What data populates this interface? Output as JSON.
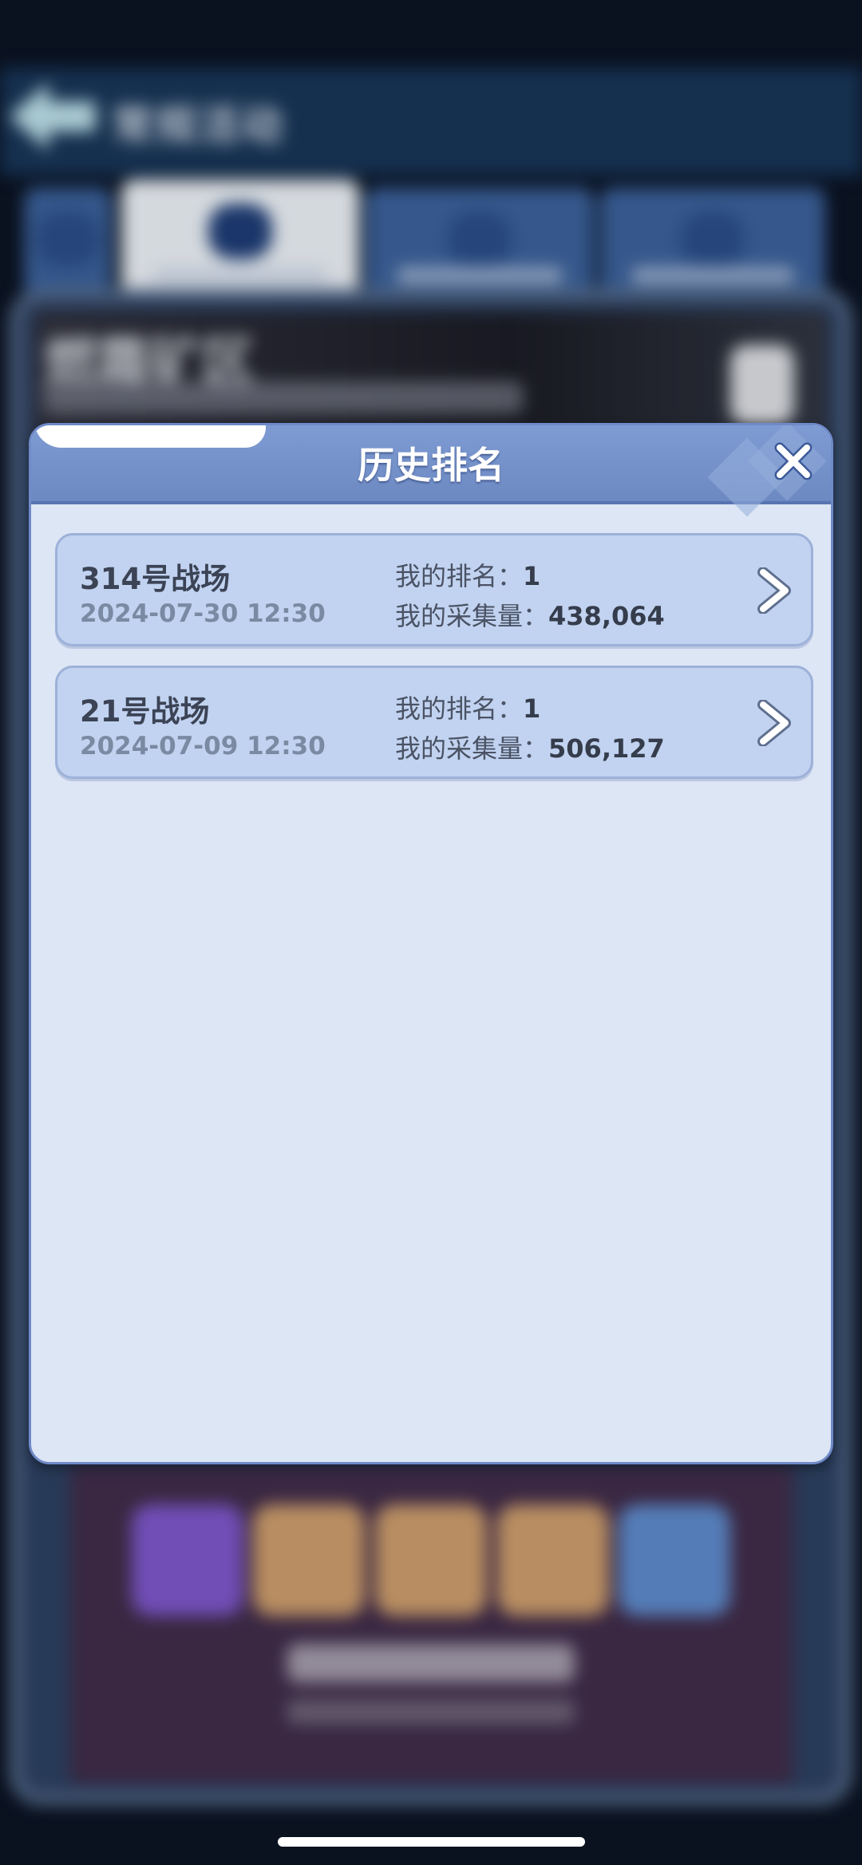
{
  "background": {
    "header_title": "常规活动",
    "banner_title": "燃霜矿区"
  },
  "modal": {
    "title": "历史排名",
    "rank_label": "我的排名：",
    "collect_label": "我的采集量：",
    "records": [
      {
        "battlefield": "314号战场",
        "datetime": "2024-07-30 12:30",
        "rank": "1",
        "collected": "438,064"
      },
      {
        "battlefield": "21号战场",
        "datetime": "2024-07-09 12:30",
        "rank": "1",
        "collected": "506,127"
      }
    ]
  },
  "colors": {
    "header_blue": "#7e9bd3",
    "panel_bg": "#dde6f5",
    "row_bg": "#c1d3f0"
  },
  "icons": [
    "back-arrow-icon",
    "close-icon",
    "chevron-right-icon"
  ]
}
